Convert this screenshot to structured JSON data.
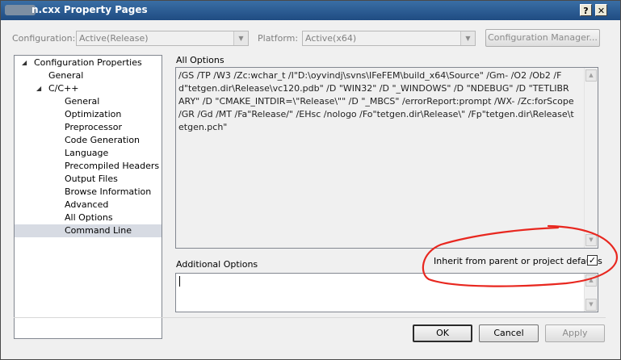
{
  "window": {
    "title": "n.cxx Property Pages",
    "help_glyph": "?",
    "close_glyph": "✕"
  },
  "toolbar": {
    "configuration_label": "Configuration:",
    "configuration_value": "Active(Release)",
    "platform_label": "Platform:",
    "platform_value": "Active(x64)",
    "manager_button": "Configuration Manager..."
  },
  "tree": {
    "items": [
      {
        "label": "Configuration Properties",
        "expander": "◢"
      },
      {
        "label": "General"
      },
      {
        "label": "C/C++",
        "expander": "◢"
      },
      {
        "label": "General"
      },
      {
        "label": "Optimization"
      },
      {
        "label": "Preprocessor"
      },
      {
        "label": "Code Generation"
      },
      {
        "label": "Language"
      },
      {
        "label": "Precompiled Headers"
      },
      {
        "label": "Output Files"
      },
      {
        "label": "Browse Information"
      },
      {
        "label": "Advanced"
      },
      {
        "label": "All Options"
      },
      {
        "label": "Command Line"
      }
    ]
  },
  "all_options": {
    "label": "All Options",
    "text": "/GS /TP /W3 /Zc:wchar_t /I\"D:\\oyvindj\\svns\\IFeFEM\\build_x64\\Source\" /Gm- /O2 /Ob2 /Fd\"tetgen.dir\\Release\\vc120.pdb\" /D \"WIN32\" /D \"_WINDOWS\" /D \"NDEBUG\" /D \"TETLIBRARY\" /D \"CMAKE_INTDIR=\\\"Release\\\"\" /D \"_MBCS\" /errorReport:prompt /WX- /Zc:forScope /GR /Gd /MT /Fa\"Release/\" /EHsc /nologo /Fo\"tetgen.dir\\Release\\\" /Fp\"tetgen.dir\\Release\\tetgen.pch\""
  },
  "additional_options": {
    "label": "Additional Options",
    "value": ""
  },
  "inherit": {
    "label": "Inherit from parent or project defaults",
    "checked": true,
    "check_glyph": "✓"
  },
  "buttons": {
    "ok": "OK",
    "cancel": "Cancel",
    "apply": "Apply"
  },
  "scroll_glyphs": {
    "up": "▲",
    "down": "▼"
  },
  "colors": {
    "annotation": "#e8271f",
    "selection": "#d7dbe3",
    "titlebar": "#1f4c82"
  }
}
